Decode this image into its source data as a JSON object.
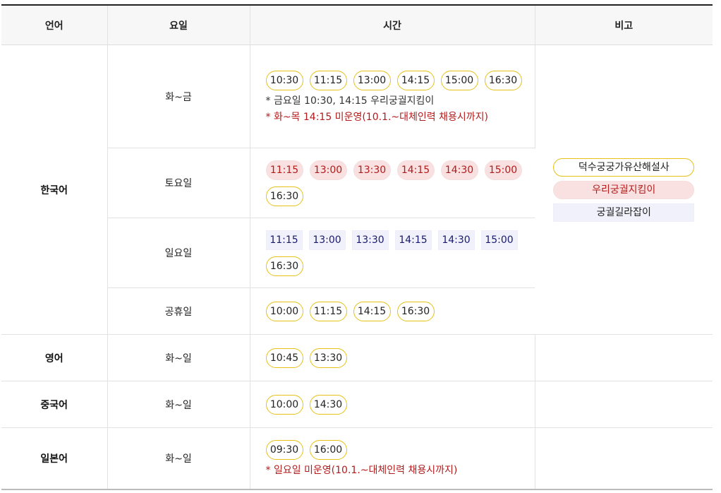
{
  "headers": [
    "언어",
    "요일",
    "시간",
    "비고"
  ],
  "korean": {
    "language": "한국어",
    "rows": [
      {
        "day": "화~금",
        "style": "yellow",
        "times": [
          "10:30",
          "11:15",
          "13:00",
          "14:15",
          "15:00",
          "16:30"
        ],
        "note1": "* 금요일 10:30, 14:15 우리궁궐지킴이",
        "note2": "* 화~목 14:15 미운영(10.1.~대체인력 채용시까지)"
      },
      {
        "day": "토요일",
        "pink_times": [
          "11:15",
          "13:00",
          "13:30",
          "14:15",
          "14:30",
          "15:00"
        ],
        "yellow_times": [
          "16:30"
        ]
      },
      {
        "day": "일요일",
        "lavender_times": [
          "11:15",
          "13:00",
          "13:30",
          "14:15",
          "14:30",
          "15:00"
        ],
        "yellow_times": [
          "16:30"
        ]
      },
      {
        "day": "공휴일",
        "times": [
          "10:00",
          "11:15",
          "14:15",
          "16:30"
        ]
      }
    ],
    "legend": [
      "덕수궁궁가유산해설사",
      "우리궁궐지킴이",
      "궁궐길라잡이"
    ]
  },
  "english": {
    "language": "영어",
    "day": "화~일",
    "times": [
      "10:45",
      "13:30"
    ]
  },
  "chinese": {
    "language": "중국어",
    "day": "화~일",
    "times": [
      "10:00",
      "14:30"
    ]
  },
  "japanese": {
    "language": "일본어",
    "day": "화~일",
    "times": [
      "09:30",
      "16:00"
    ],
    "note": "* 일요일 미운영(10.1.~대체인력 채용시까지)"
  },
  "colors": {
    "yellow_border": "#e7c11a",
    "pink_fill": "#f9e1e1",
    "lavender_fill": "#f1f1fb",
    "note_red": "#b31b1b"
  }
}
